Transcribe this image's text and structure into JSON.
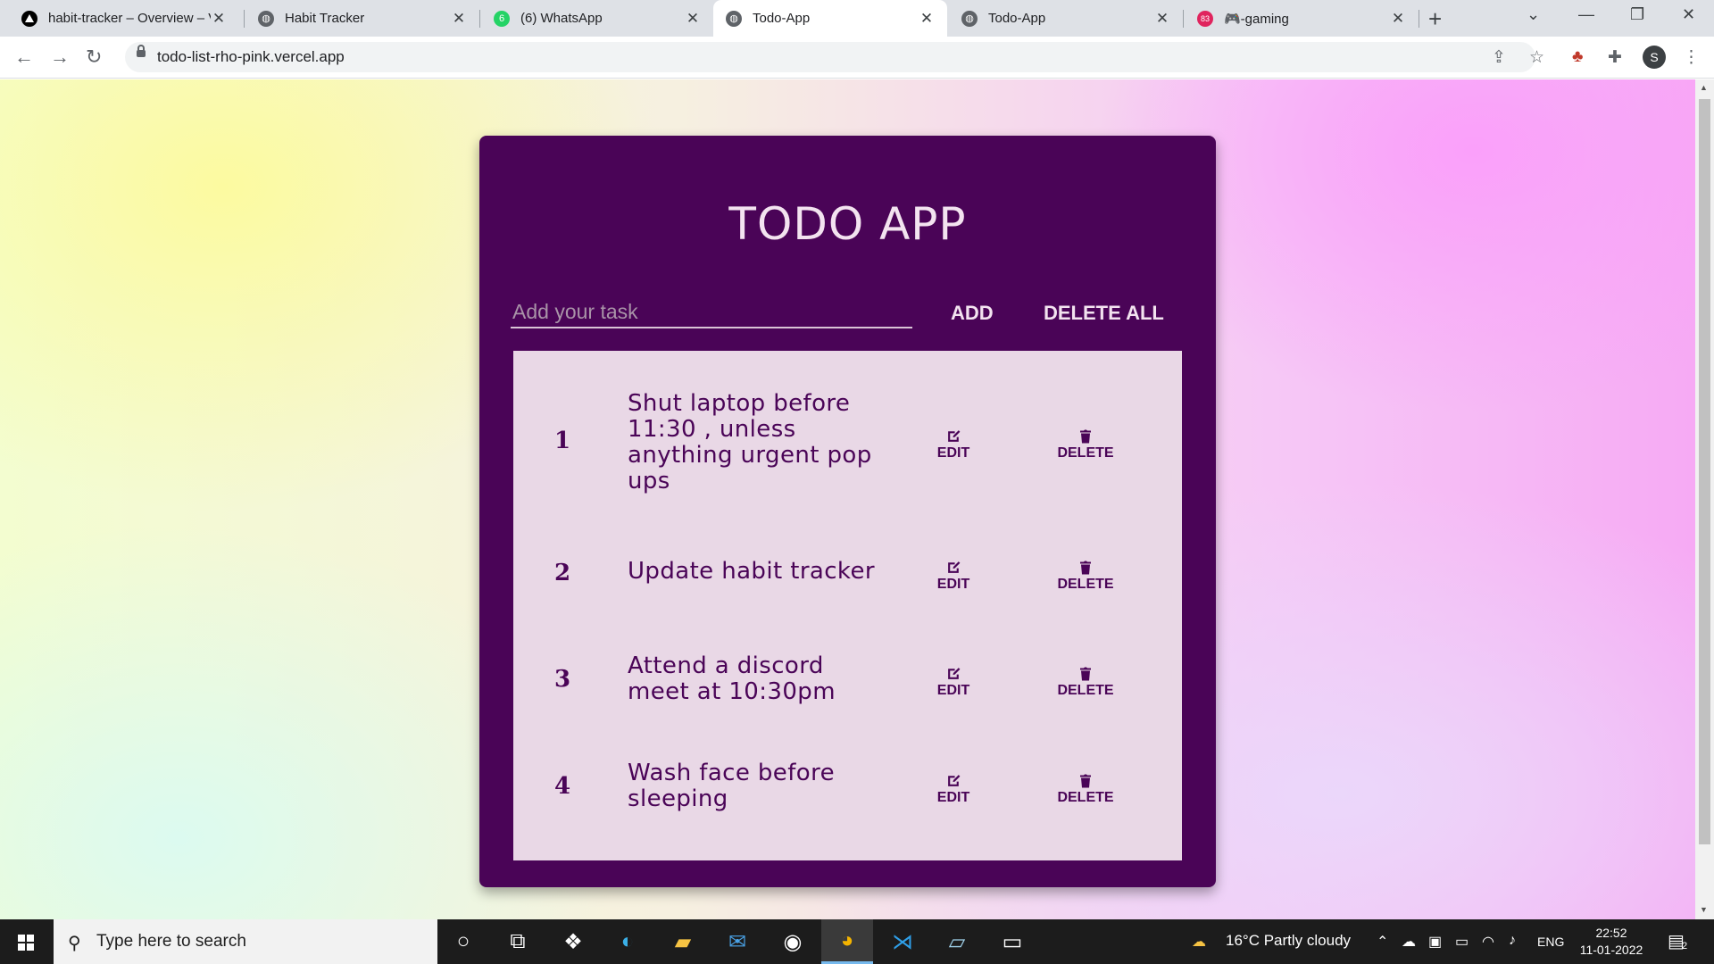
{
  "browser": {
    "tabs": [
      {
        "title": "habit-tracker – Overview – V",
        "favicon": "vercel-icon"
      },
      {
        "title": "Habit Tracker",
        "favicon": "globe-icon"
      },
      {
        "title": "(6) WhatsApp",
        "favicon": "whatsapp-icon",
        "badge": "6"
      },
      {
        "title": "Todo-App",
        "favicon": "globe-icon",
        "active": true
      },
      {
        "title": "Todo-App",
        "favicon": "globe-icon"
      },
      {
        "title": "🎮-gaming",
        "favicon": "discord-icon",
        "badge": "83"
      }
    ],
    "url": "todo-list-rho-pink.vercel.app",
    "profile_initial": "S"
  },
  "app": {
    "title": "TODO APP",
    "input_placeholder": "Add your task",
    "add_label": "ADD",
    "delete_all_label": "DELETE ALL",
    "edit_label": "EDIT",
    "delete_label": "DELETE",
    "colors": {
      "card": "#4a0457",
      "list": "#e9d8e6",
      "text": "#f3e3f0"
    },
    "tasks": [
      {
        "num": "1",
        "text": "Shut laptop before 11:30 , unless anything urgent pop ups"
      },
      {
        "num": "2",
        "text": "Update habit tracker"
      },
      {
        "num": "3",
        "text": "Attend a discord meet at 10:30pm"
      },
      {
        "num": "4",
        "text": "Wash face before sleeping"
      }
    ]
  },
  "taskbar": {
    "search_placeholder": "Type here to search",
    "weather": "16°C  Partly cloudy",
    "language": "ENG",
    "time": "22:52",
    "date": "11-01-2022",
    "notification_count": "2"
  }
}
